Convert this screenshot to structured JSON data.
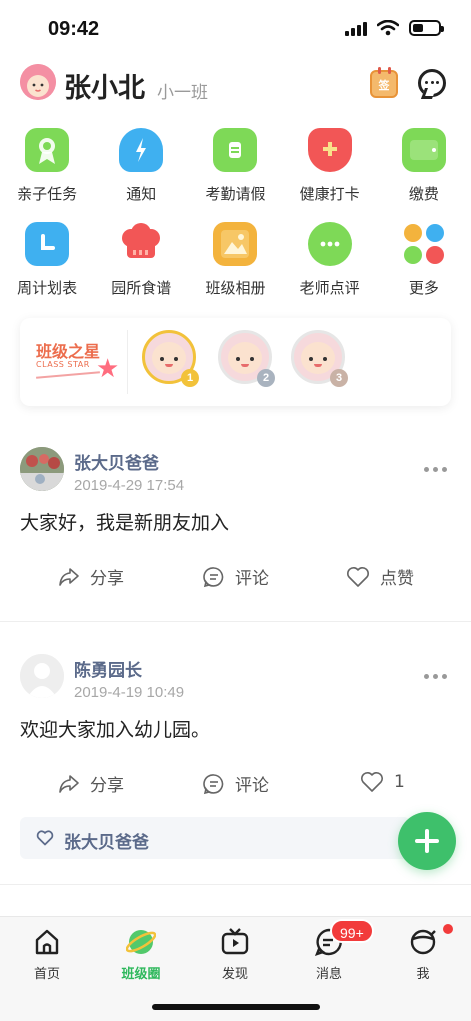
{
  "status_bar": {
    "time": "09:42"
  },
  "header": {
    "user_name": "张小北",
    "class_name": "小一班",
    "calendar_label": "签"
  },
  "features": [
    {
      "label": "亲子任务",
      "icon": "medal-icon",
      "color": "#7ed957"
    },
    {
      "label": "通知",
      "icon": "bell-icon",
      "color": "#3fb0f0"
    },
    {
      "label": "考勤请假",
      "icon": "clipboard-icon",
      "color": "#7ed957"
    },
    {
      "label": "健康打卡",
      "icon": "shield-icon",
      "color": "#f25656"
    },
    {
      "label": "缴费",
      "icon": "wallet-icon",
      "color": "#7ed957"
    },
    {
      "label": "周计划表",
      "icon": "calendar-icon",
      "color": "#3fb0f0"
    },
    {
      "label": "园所食谱",
      "icon": "chef-hat-icon",
      "color": "#f25656"
    },
    {
      "label": "班级相册",
      "icon": "photo-icon",
      "color": "#f3b33d"
    },
    {
      "label": "老师点评",
      "icon": "comment-icon",
      "color": "#7ed957"
    },
    {
      "label": "更多",
      "icon": "more-grid-icon",
      "color": "#f3b33d"
    }
  ],
  "class_star": {
    "title": "班级之星",
    "subtitle": "CLASS STAR",
    "ranks": [
      "1",
      "2",
      "3"
    ]
  },
  "posts": [
    {
      "author": "张大贝爸爸",
      "time": "2019-4-29 17:54",
      "content": "大家好，我是新朋友加入",
      "actions": {
        "share": "分享",
        "comment": "评论",
        "like": "点赞"
      }
    },
    {
      "author": "陈勇园长",
      "time": "2019-4-19 10:49",
      "content": "欢迎大家加入幼儿园。",
      "actions": {
        "share": "分享",
        "comment": "评论",
        "like": "1"
      },
      "liked_by": "张大贝爸爸"
    }
  ],
  "tabbar": {
    "items": [
      {
        "label": "首页"
      },
      {
        "label": "班级圈"
      },
      {
        "label": "发现"
      },
      {
        "label": "消息"
      },
      {
        "label": "我"
      }
    ],
    "message_badge": "99+"
  }
}
